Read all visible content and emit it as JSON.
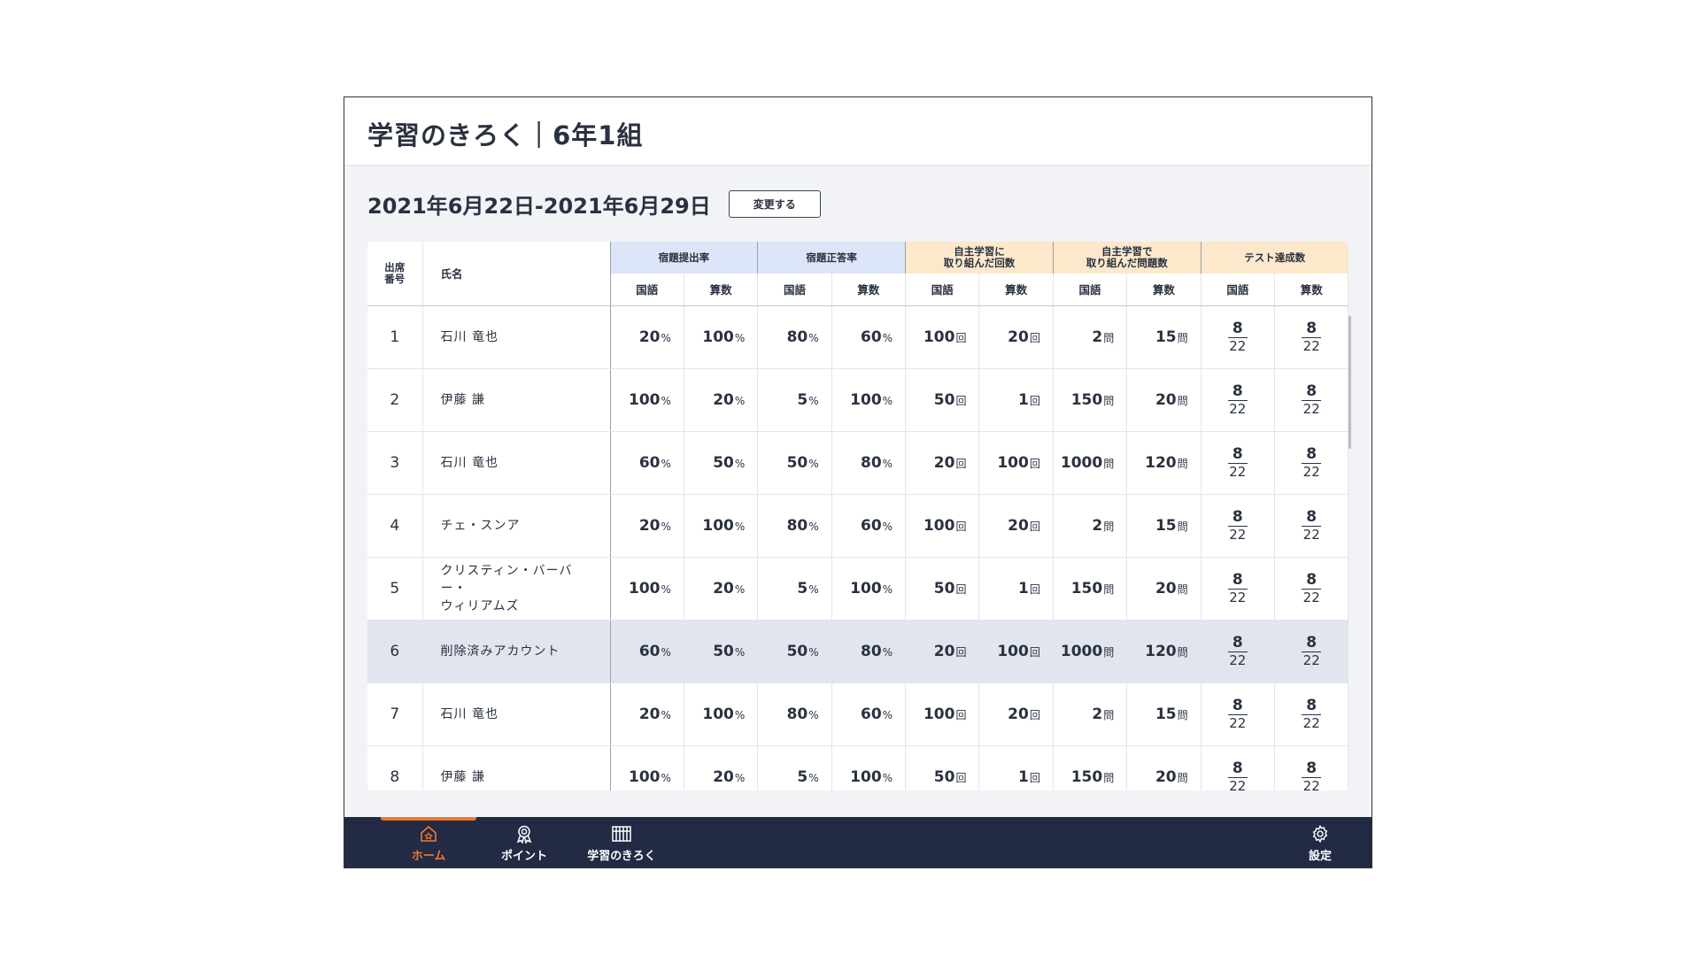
{
  "app": {
    "title": "学習のきろく｜6年1組"
  },
  "period": {
    "range": "2021年6月22日-2021年6月29日",
    "change_label": "変更する"
  },
  "table": {
    "col_no": "出席\n番号",
    "col_name": "氏名",
    "groups": [
      {
        "label": "宿題提出率",
        "color": "blue"
      },
      {
        "label": "宿題正答率",
        "color": "blue"
      },
      {
        "label": "自主学習に\n取り組んだ回数",
        "color": "peach"
      },
      {
        "label": "自主学習で\n取り組んだ問題数",
        "color": "peach"
      },
      {
        "label": "テスト達成数",
        "color": "peach"
      }
    ],
    "sub_headers": [
      "国語",
      "算数"
    ],
    "units": {
      "rate": "%",
      "count": "回",
      "problems": "問"
    },
    "rows": [
      {
        "no": "1",
        "name": "石川 竜也",
        "submit": [
          "20",
          "100"
        ],
        "correct": [
          "80",
          "60"
        ],
        "count": [
          "100",
          "20"
        ],
        "problems": [
          "2",
          "15"
        ],
        "test": [
          [
            "8",
            "22"
          ],
          [
            "8",
            "22"
          ]
        ],
        "deleted": false
      },
      {
        "no": "2",
        "name": "伊藤 謙",
        "submit": [
          "100",
          "20"
        ],
        "correct": [
          "5",
          "100"
        ],
        "count": [
          "50",
          "1"
        ],
        "problems": [
          "150",
          "20"
        ],
        "test": [
          [
            "8",
            "22"
          ],
          [
            "8",
            "22"
          ]
        ],
        "deleted": false
      },
      {
        "no": "3",
        "name": "石川 竜也",
        "submit": [
          "60",
          "50"
        ],
        "correct": [
          "50",
          "80"
        ],
        "count": [
          "20",
          "100"
        ],
        "problems": [
          "1000",
          "120"
        ],
        "test": [
          [
            "8",
            "22"
          ],
          [
            "8",
            "22"
          ]
        ],
        "deleted": false
      },
      {
        "no": "4",
        "name": "チェ・スンア",
        "submit": [
          "20",
          "100"
        ],
        "correct": [
          "80",
          "60"
        ],
        "count": [
          "100",
          "20"
        ],
        "problems": [
          "2",
          "15"
        ],
        "test": [
          [
            "8",
            "22"
          ],
          [
            "8",
            "22"
          ]
        ],
        "deleted": false
      },
      {
        "no": "5",
        "name": "クリスティン・バーバー・\nウィリアムズ",
        "submit": [
          "100",
          "20"
        ],
        "correct": [
          "5",
          "100"
        ],
        "count": [
          "50",
          "1"
        ],
        "problems": [
          "150",
          "20"
        ],
        "test": [
          [
            "8",
            "22"
          ],
          [
            "8",
            "22"
          ]
        ],
        "deleted": false
      },
      {
        "no": "6",
        "name": "削除済みアカウント",
        "submit": [
          "60",
          "50"
        ],
        "correct": [
          "50",
          "80"
        ],
        "count": [
          "20",
          "100"
        ],
        "problems": [
          "1000",
          "120"
        ],
        "test": [
          [
            "8",
            "22"
          ],
          [
            "8",
            "22"
          ]
        ],
        "deleted": true
      },
      {
        "no": "7",
        "name": "石川 竜也",
        "submit": [
          "20",
          "100"
        ],
        "correct": [
          "80",
          "60"
        ],
        "count": [
          "100",
          "20"
        ],
        "problems": [
          "2",
          "15"
        ],
        "test": [
          [
            "8",
            "22"
          ],
          [
            "8",
            "22"
          ]
        ],
        "deleted": false
      },
      {
        "no": "8",
        "name": "伊藤 謙",
        "submit": [
          "100",
          "20"
        ],
        "correct": [
          "5",
          "100"
        ],
        "count": [
          "50",
          "1"
        ],
        "problems": [
          "150",
          "20"
        ],
        "test": [
          [
            "8",
            "22"
          ],
          [
            "8",
            "22"
          ]
        ],
        "deleted": false
      }
    ]
  },
  "nav": {
    "items": [
      {
        "label": "ホーム",
        "icon": "home-icon",
        "active": true
      },
      {
        "label": "ポイント",
        "icon": "medal-icon",
        "active": false
      },
      {
        "label": "学習のきろく",
        "icon": "records-icon",
        "active": false
      },
      {
        "label": "設定",
        "icon": "gear-icon",
        "active": false
      }
    ],
    "active_color": "#f07a2c",
    "bar_color": "#222a44"
  }
}
